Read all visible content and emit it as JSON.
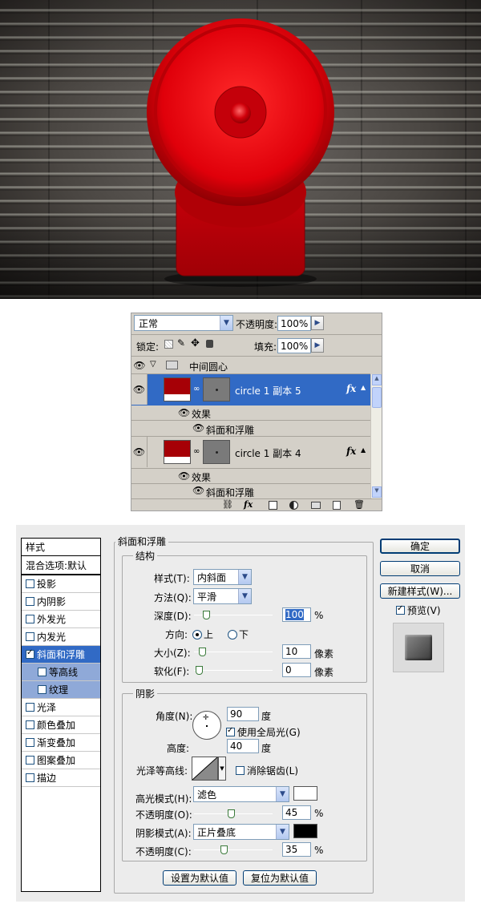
{
  "layers_panel": {
    "blend_mode": "正常",
    "opacity_label": "不透明度:",
    "opacity_value": "100%",
    "lock_label": "锁定:",
    "fill_label": "填充:",
    "fill_value": "100%",
    "group_name": "中间圆心",
    "layers": [
      {
        "name": "circle 1 副本 5",
        "effects_label": "效果",
        "effect": "斜面和浮雕",
        "selected": true
      },
      {
        "name": "circle 1 副本 4",
        "effects_label": "效果",
        "effect": "斜面和浮雕",
        "selected": false
      }
    ],
    "fx_label": "fx"
  },
  "dialog": {
    "styles_header": "样式",
    "blend_options": "混合选项:默认",
    "style_items": [
      {
        "label": "投影",
        "checked": false,
        "sub": false,
        "active": false
      },
      {
        "label": "内阴影",
        "checked": false,
        "sub": false,
        "active": false
      },
      {
        "label": "外发光",
        "checked": false,
        "sub": false,
        "active": false
      },
      {
        "label": "内发光",
        "checked": false,
        "sub": false,
        "active": false
      },
      {
        "label": "斜面和浮雕",
        "checked": true,
        "sub": false,
        "active": true
      },
      {
        "label": "等高线",
        "checked": false,
        "sub": true,
        "active": false
      },
      {
        "label": "纹理",
        "checked": false,
        "sub": true,
        "active": false
      },
      {
        "label": "光泽",
        "checked": false,
        "sub": false,
        "active": false
      },
      {
        "label": "颜色叠加",
        "checked": false,
        "sub": false,
        "active": false
      },
      {
        "label": "渐变叠加",
        "checked": false,
        "sub": false,
        "active": false
      },
      {
        "label": "图案叠加",
        "checked": false,
        "sub": false,
        "active": false
      },
      {
        "label": "描边",
        "checked": false,
        "sub": false,
        "active": false
      }
    ],
    "section_title": "斜面和浮雕",
    "structure": {
      "title": "结构",
      "style_label": "样式(T):",
      "style_value": "内斜面",
      "technique_label": "方法(Q):",
      "technique_value": "平滑",
      "depth_label": "深度(D):",
      "depth_value": "100",
      "depth_unit": "%",
      "depth_level": 0.1,
      "direction_label": "方向:",
      "direction_up": "上",
      "direction_down": "下",
      "size_label": "大小(Z):",
      "size_value": "10",
      "size_unit": "像素",
      "size_level": 0.05,
      "soften_label": "软化(F):",
      "soften_value": "0",
      "soften_unit": "像素",
      "soften_level": 0
    },
    "shading": {
      "title": "阴影",
      "angle_label": "角度(N):",
      "angle_value": "90",
      "angle_unit": "度",
      "global_light_label": "使用全局光(G)",
      "altitude_label": "高度:",
      "altitude_value": "40",
      "altitude_unit": "度",
      "gloss_label": "光泽等高线:",
      "antialias_label": "消除锯齿(L)",
      "highlight_mode_label": "高光模式(H):",
      "highlight_mode_value": "滤色",
      "highlight_color": "#ffffff",
      "highlight_opacity_label": "不透明度(O):",
      "highlight_opacity_value": "45",
      "highlight_opacity_level": 0.45,
      "shadow_mode_label": "阴影模式(A):",
      "shadow_mode_value": "正片叠底",
      "shadow_color": "#000000",
      "shadow_opacity_label": "不透明度(C):",
      "shadow_opacity_value": "35",
      "shadow_opacity_level": 0.35,
      "percent": "%"
    },
    "make_default": "设置为默认值",
    "reset_default": "复位为默认值",
    "ok": "确定",
    "cancel": "取消",
    "new_style": "新建样式(W)...",
    "preview_label": "预览(V)"
  },
  "colors": {
    "selection_blue": "#316ac5",
    "accent_red": "#a60006"
  }
}
